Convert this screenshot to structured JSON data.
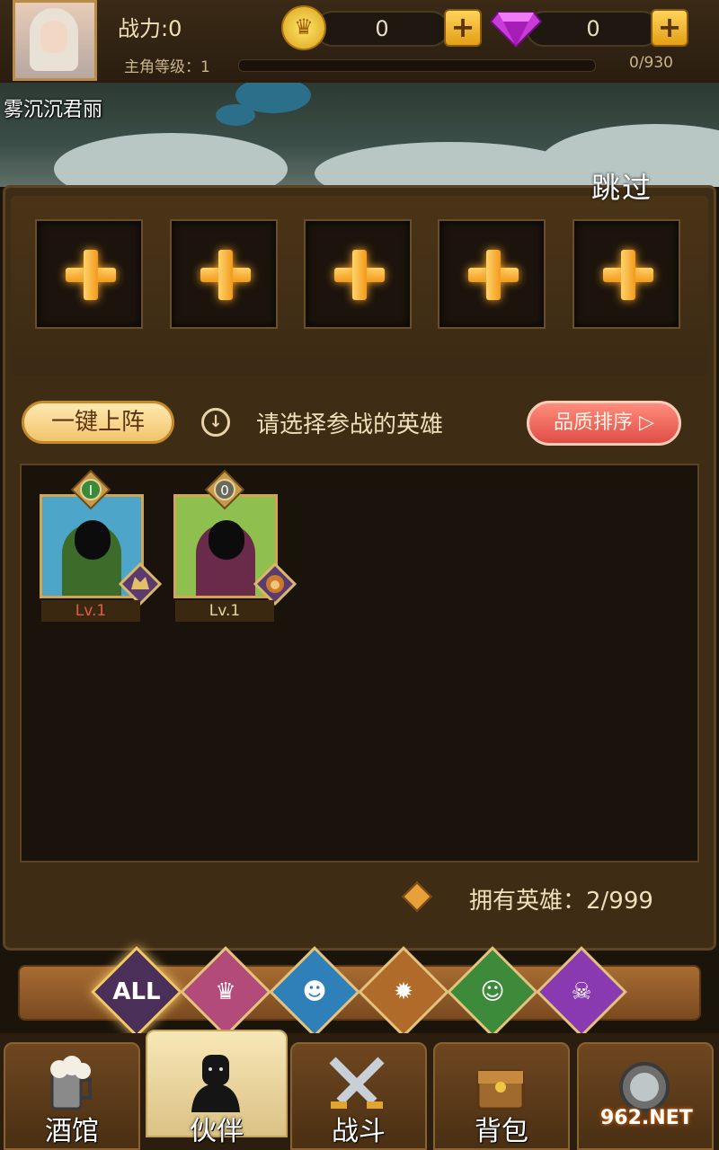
{
  "header": {
    "power_label": "战力:0",
    "level_label": "主角等级：1",
    "xp_text": "0/930",
    "gold_value": "0",
    "gem_value": "0",
    "gold_icon_glyph": "♛"
  },
  "hero_name": "雾沉沉君丽",
  "skip_label": "跳过",
  "slots": [
    "+",
    "+",
    "+",
    "+",
    "+"
  ],
  "actions": {
    "auto_deploy": "一键上阵",
    "hint": "请选择参战的英雄",
    "sort": "品质排序 ▷",
    "down_glyph": "↓"
  },
  "heroes": [
    {
      "rank": "I",
      "level": "Lv.1",
      "bg": "#4da6c9",
      "cloak": "#3d6b2a",
      "rank_color": "#6fcf5a",
      "lvl_color": "#e25b4b"
    },
    {
      "rank": "0",
      "level": "Lv.1",
      "bg": "#8fbf4f",
      "cloak": "#6a2a4a",
      "rank_color": "#e8d7a0",
      "lvl_color": "#e8d7a0"
    }
  ],
  "owned_label": "拥有英雄：2/999",
  "filters": [
    "ALL",
    "",
    "",
    "",
    "",
    ""
  ],
  "filter_icons": [
    "all-icon",
    "knight-icon",
    "fishman-icon",
    "lion-icon",
    "elf-icon",
    "demon-icon"
  ],
  "nav": [
    {
      "label": "酒馆",
      "icon": "beer-mug-icon"
    },
    {
      "label": "伙伴",
      "icon": "partner-icon"
    },
    {
      "label": "战斗",
      "icon": "crossed-swords-icon"
    },
    {
      "label": "背包",
      "icon": "chest-icon"
    },
    {
      "label": "",
      "icon": "portal-icon"
    }
  ],
  "watermark": "962.NET"
}
